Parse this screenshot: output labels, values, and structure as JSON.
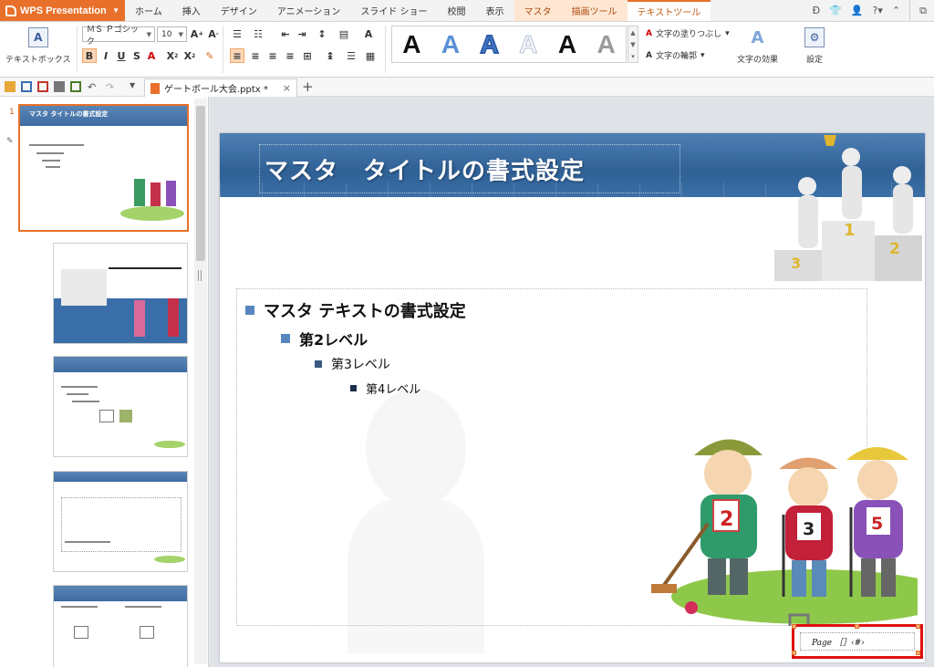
{
  "app": {
    "name": "WPS Presentation"
  },
  "menu": {
    "tabs": [
      "ホーム",
      "挿入",
      "デザイン",
      "アニメーション",
      "スライド ショー",
      "校閲",
      "表示"
    ],
    "context_tabs": [
      "マスタ",
      "描画ツール"
    ],
    "active_tab": "テキストツール"
  },
  "ribbon": {
    "textbox_label": "テキストボックス",
    "font_name": "ＭＳ Ｐゴシック",
    "font_size": "10",
    "fill_label": "文字の塗りつぶし",
    "outline_label": "文字の輪郭",
    "effect_label": "文字の効果",
    "settings_label": "設定",
    "gallery_colors": [
      "#111111",
      "#5b8fd6",
      "#4a7fc8",
      "#dfe6ee",
      "#111111",
      "#9a9a9a"
    ]
  },
  "document": {
    "tab_title": "ゲートボール大会.pptx *"
  },
  "sidebar": {
    "selected_slide_number": "1",
    "thumb_title_1": "マスタ タイトルの書式設定"
  },
  "slide": {
    "title": "マスタ　タイトルの書式設定",
    "level1": "マスタ テキストの書式設定",
    "level2": "第2レベル",
    "level3": "第3レベル",
    "level4": "第4レベル",
    "footer": "Page ［］‹#›",
    "badges": [
      "1",
      "2",
      "3",
      "2",
      "3",
      "5"
    ]
  }
}
